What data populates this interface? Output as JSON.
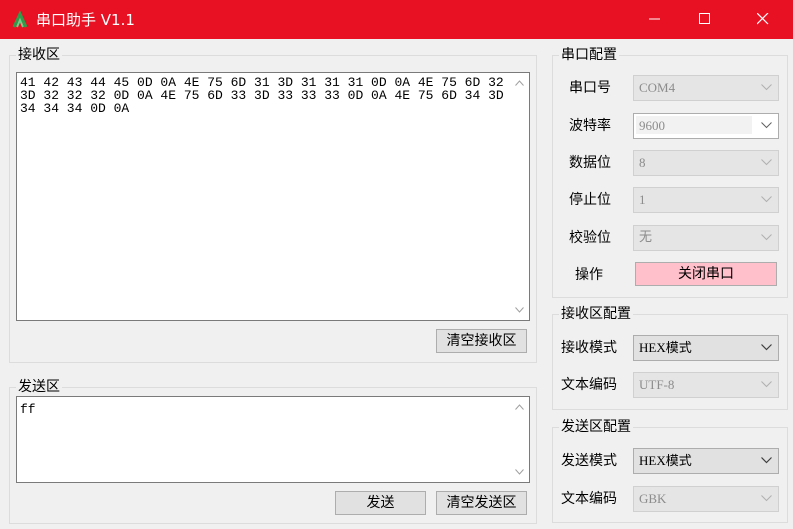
{
  "window": {
    "title": "串口助手 V1.1"
  },
  "receive": {
    "group_title": "接收区",
    "content": "41 42 43 44 45 0D 0A 4E 75 6D 31 3D 31 31 31 0D 0A 4E 75 6D 32 3D 32 32 32 0D 0A 4E 75 6D 33 3D 33 33 33 0D 0A 4E 75 6D 34 3D 34 34 34 0D 0A",
    "clear_label": "清空接收区"
  },
  "send": {
    "group_title": "发送区",
    "content": "ff",
    "send_label": "发送",
    "clear_label": "清空发送区"
  },
  "serial_config": {
    "group_title": "串口配置",
    "port_label": "串口号",
    "port_value": "COM4",
    "baud_label": "波特率",
    "baud_value": "9600",
    "databits_label": "数据位",
    "databits_value": "8",
    "stopbits_label": "停止位",
    "stopbits_value": "1",
    "parity_label": "校验位",
    "parity_value": "无",
    "action_label": "操作",
    "action_button": "关闭串口"
  },
  "receive_config": {
    "group_title": "接收区配置",
    "mode_label": "接收模式",
    "mode_value": "HEX模式",
    "encoding_label": "文本编码",
    "encoding_value": "UTF-8"
  },
  "send_config": {
    "group_title": "发送区配置",
    "mode_label": "发送模式",
    "mode_value": "HEX模式",
    "encoding_label": "文本编码",
    "encoding_value": "GBK"
  },
  "colors": {
    "titlebar": "#e81123",
    "action_button": "#ffc0cb"
  },
  "icons": {
    "app": "app-icon",
    "minimize": "minimize-icon",
    "maximize": "maximize-icon",
    "close": "close-icon",
    "dropdown": "chevron-down-icon",
    "scroll_up": "scroll-up-arrow-icon",
    "scroll_down": "scroll-down-arrow-icon"
  }
}
